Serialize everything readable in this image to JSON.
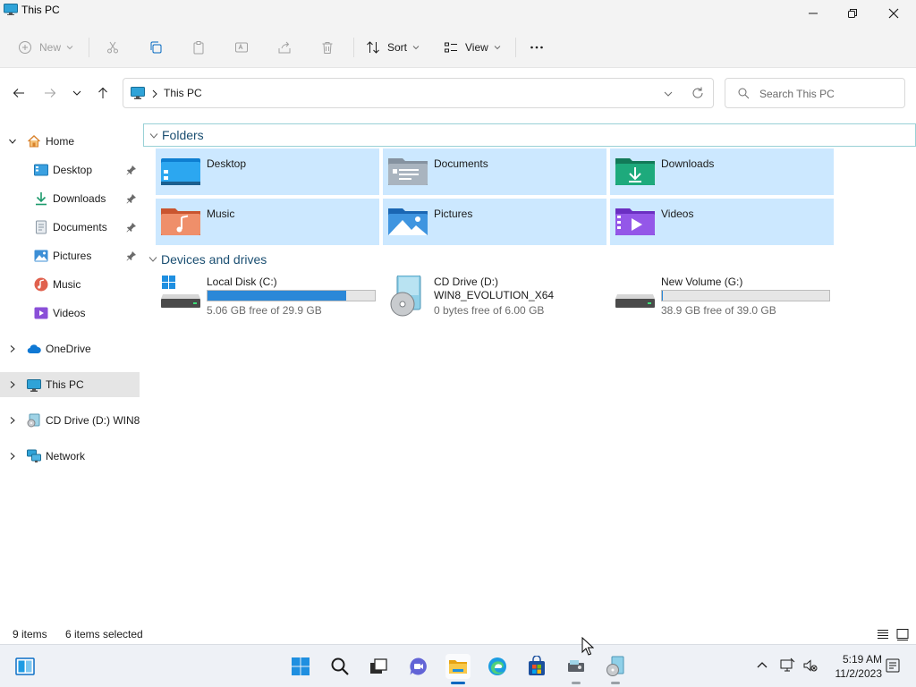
{
  "window": {
    "title": "This PC"
  },
  "toolbar": {
    "new_label": "New",
    "sort_label": "Sort",
    "view_label": "View",
    "more_label": "···"
  },
  "address": {
    "crumb": "This PC",
    "search_placeholder": "Search This PC"
  },
  "nav": {
    "home": "Home",
    "quick": [
      {
        "label": "Desktop",
        "icon": "desktop-icon"
      },
      {
        "label": "Downloads",
        "icon": "downloads-icon"
      },
      {
        "label": "Documents",
        "icon": "documents-icon"
      },
      {
        "label": "Pictures",
        "icon": "pictures-icon"
      },
      {
        "label": "Music",
        "icon": "music-icon"
      },
      {
        "label": "Videos",
        "icon": "videos-icon"
      }
    ],
    "onedrive": "OneDrive",
    "this_pc": "This PC",
    "cd_drive": "CD Drive (D:) WIN8_",
    "network": "Network"
  },
  "content": {
    "folders_header": "Folders",
    "folders": [
      {
        "label": "Desktop",
        "icon": "desktop-folder-icon"
      },
      {
        "label": "Documents",
        "icon": "documents-folder-icon"
      },
      {
        "label": "Downloads",
        "icon": "downloads-folder-icon"
      },
      {
        "label": "Music",
        "icon": "music-folder-icon"
      },
      {
        "label": "Pictures",
        "icon": "pictures-folder-icon"
      },
      {
        "label": "Videos",
        "icon": "videos-folder-icon"
      }
    ],
    "drives_header": "Devices and drives",
    "drives": {
      "c": {
        "name": "Local Disk (C:)",
        "free": "5.06 GB free of 29.9 GB",
        "used_fraction": 0.83
      },
      "d": {
        "name": "CD Drive (D:)",
        "sub": "WIN8_EVOLUTION_X64",
        "free": "0 bytes free of 6.00 GB"
      },
      "g": {
        "name": "New Volume (G:)",
        "free": "38.9 GB free of 39.0 GB",
        "used_fraction": 0.003
      }
    }
  },
  "status": {
    "items": "9 items",
    "selected": "6 items selected"
  },
  "clock": {
    "time": "5:19 AM",
    "date": "11/2/2023"
  },
  "colors": {
    "accent": "#0067c0",
    "tile_selected": "#cce8ff",
    "drive_bar": "#2b88d8"
  }
}
